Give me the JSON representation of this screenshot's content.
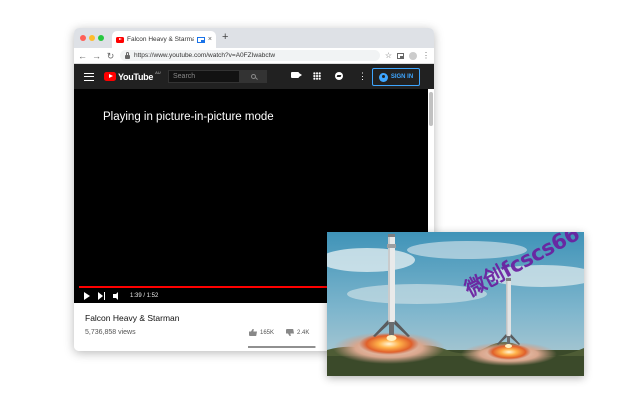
{
  "browser": {
    "tab": {
      "title": "Falcon Heavy & Starman",
      "close": "×"
    },
    "new_tab": "+",
    "url": "https://www.youtube.com/watch?v=A0FZIwabctw"
  },
  "youtube": {
    "logo_text": "YouTube",
    "logo_region": "AU",
    "search_placeholder": "Search",
    "sign_in": "SIGN IN",
    "pip_message": "Playing in picture-in-picture mode",
    "time": "1:39 / 1:52",
    "progress": 0.884,
    "video_title": "Falcon Heavy & Starman",
    "views": "5,736,858 views",
    "likes": "165K",
    "dislikes": "2.4K",
    "like_ratio": 0.986
  },
  "pip_window": {
    "watermark": "微创fcscs66"
  },
  "colors": {
    "accent": "#ff0000",
    "signin": "#3ea6ff",
    "header": "#212121"
  }
}
